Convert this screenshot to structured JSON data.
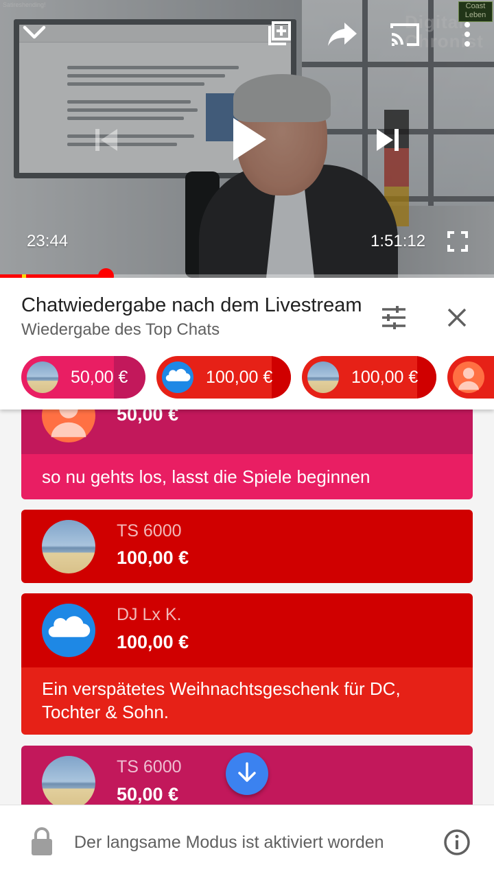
{
  "player": {
    "current_time": "23:44",
    "duration": "1:51:12",
    "progress_fraction": 0.2134,
    "buffer_marker_fraction": 0.045,
    "watermark_line1": "Digital",
    "watermark_line2": "Chronist",
    "badge_text": "Coast Leben",
    "corner_label": "Satireshending!"
  },
  "chat": {
    "title": "Chatwiedergabe nach dem Livestream",
    "subtitle": "Wiedergabe des Top Chats"
  },
  "ticker": [
    {
      "amount": "50,00 €",
      "avatar": "beach",
      "color": "#e91e63",
      "end_color": "#c2185b"
    },
    {
      "amount": "100,00 €",
      "avatar": "sound",
      "color": "#e62117",
      "end_color": "#d00000"
    },
    {
      "amount": "100,00 €",
      "avatar": "beach",
      "color": "#e62117",
      "end_color": "#d00000"
    },
    {
      "amount": "",
      "avatar": "person",
      "color": "#e62117",
      "end_color": "#d00000"
    }
  ],
  "messages": [
    {
      "author": "",
      "amount": "50,00 €",
      "text": "so nu gehts los, lasst die Spiele beginnen",
      "avatar": "person",
      "head_color": "#c2185b",
      "body_color": "#e91e63"
    },
    {
      "author": "TS 6000",
      "amount": "100,00 €",
      "text": "",
      "avatar": "beach",
      "head_color": "#d00000",
      "body_color": "#e62117"
    },
    {
      "author": "DJ Lx K.",
      "amount": "100,00 €",
      "text": "Ein verspätetes Weihnachtsgeschenk für DC, Tochter & Sohn.",
      "avatar": "sound",
      "head_color": "#d00000",
      "body_color": "#e62117"
    },
    {
      "author": "TS 6000",
      "amount": "50,00 €",
      "text": "",
      "avatar": "beach",
      "head_color": "#c2185b",
      "body_color": "#e91e63"
    }
  ],
  "footer": {
    "text": "Der langsame Modus ist aktiviert worden"
  },
  "icons": {
    "minimize": "chevron-down-icon",
    "add_to_playlist": "playlist-add-icon",
    "share": "share-icon",
    "cast": "cast-icon",
    "more": "more-vert-icon",
    "previous": "skip-previous-icon",
    "play": "play-icon",
    "next": "skip-next-icon",
    "fullscreen": "fullscreen-icon",
    "filter": "tune-icon",
    "close": "close-icon",
    "lock": "lock-icon",
    "info": "info-icon",
    "scroll_down": "arrow-down-icon"
  }
}
